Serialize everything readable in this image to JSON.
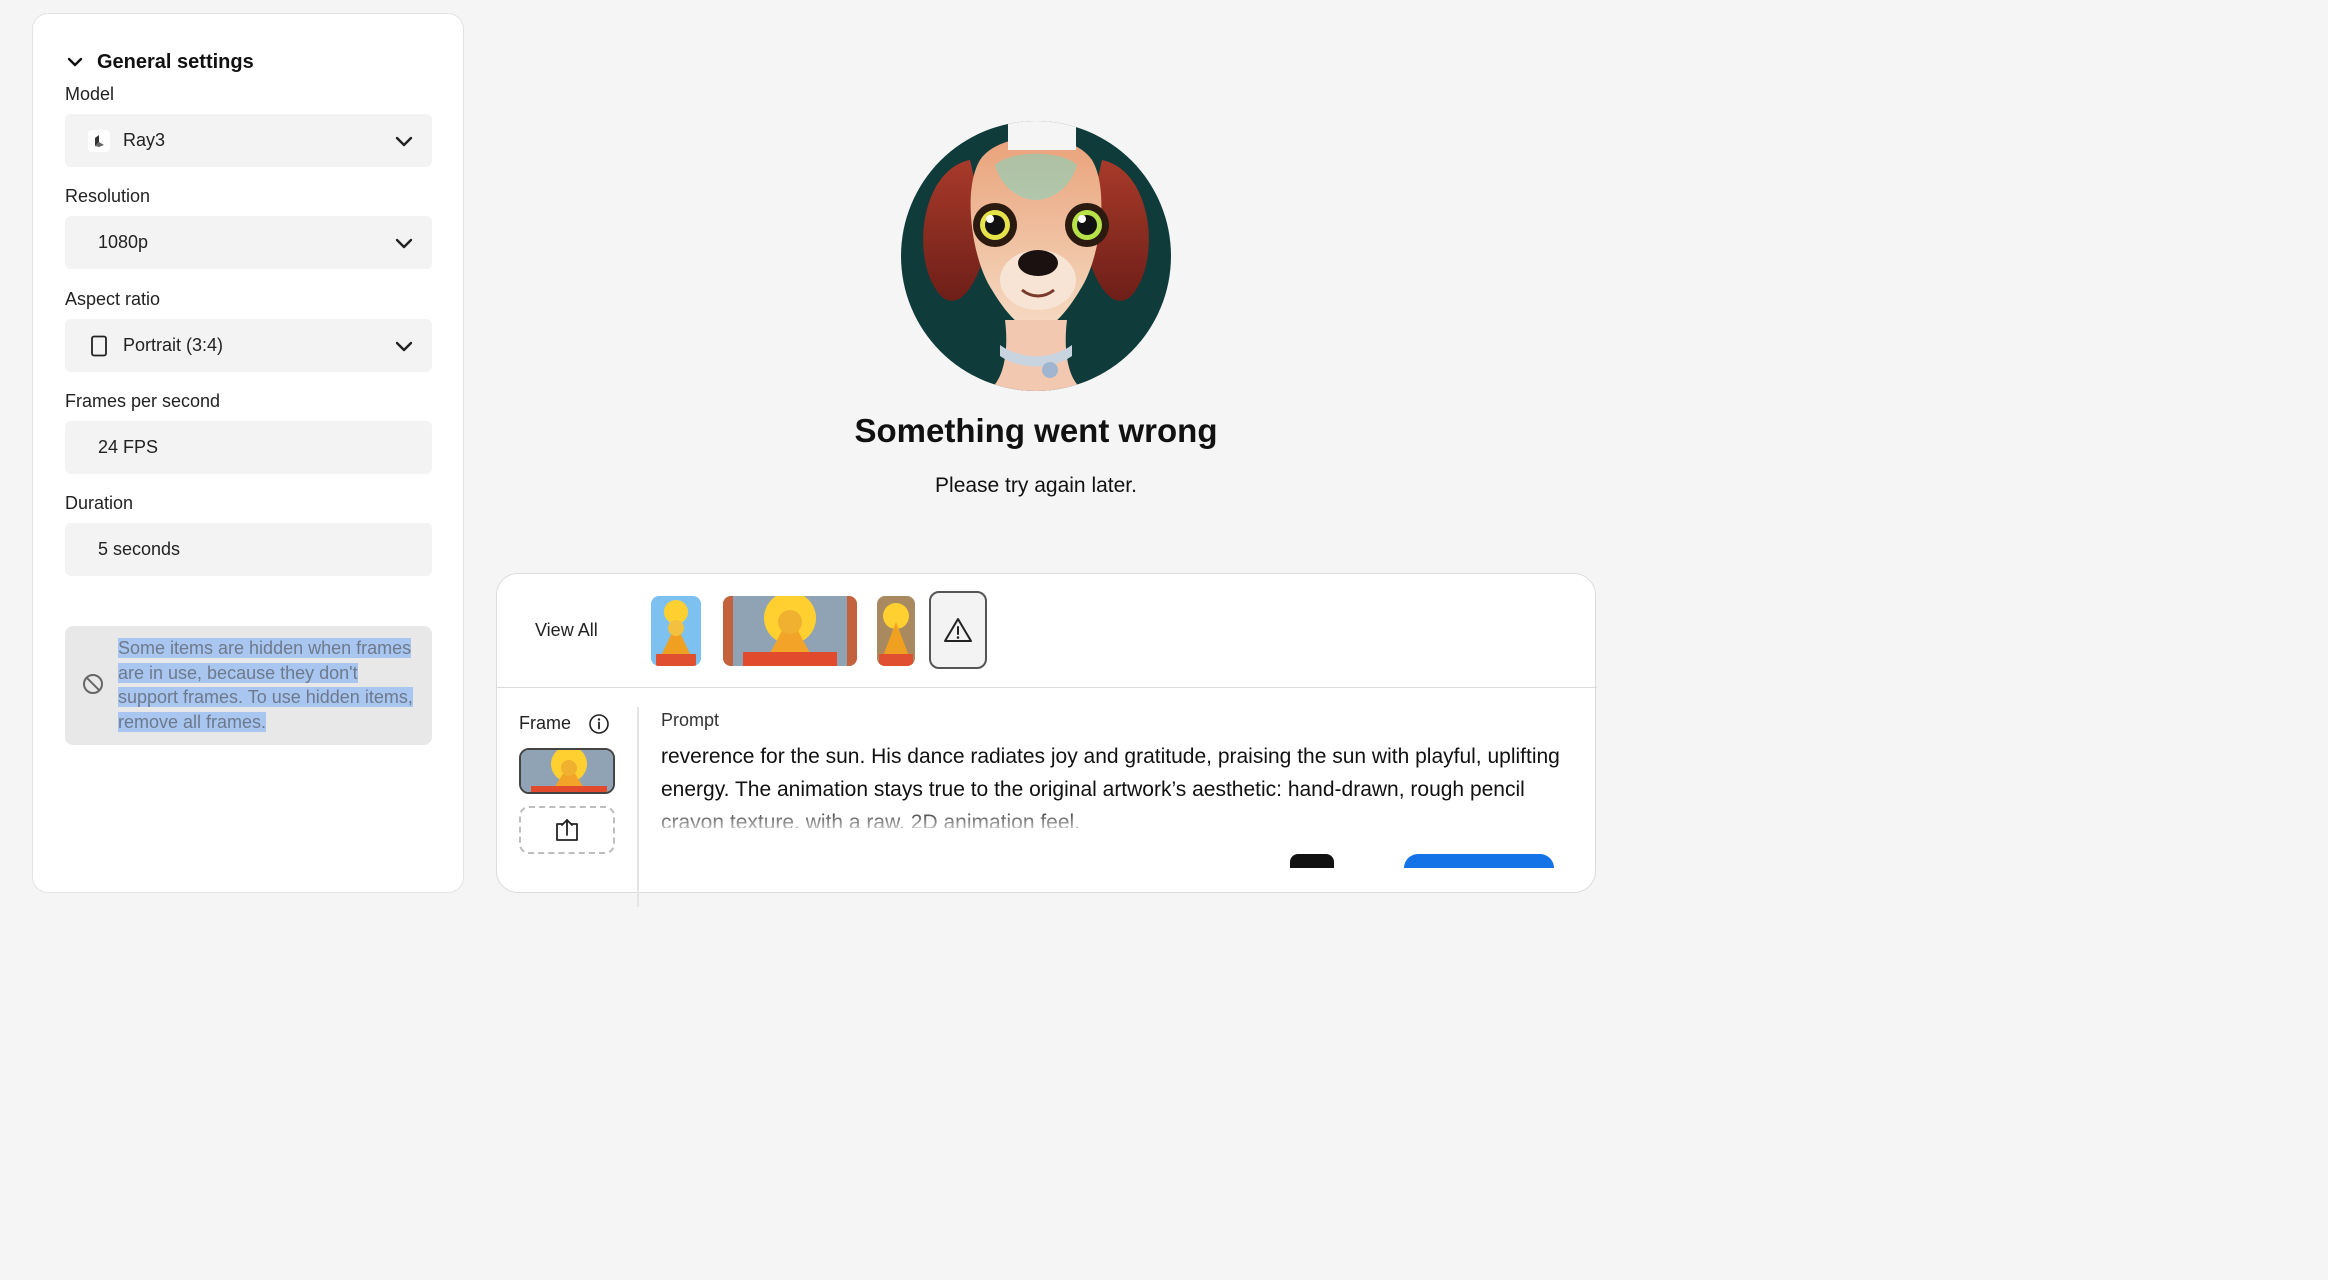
{
  "settings": {
    "section_title": "General settings",
    "model": {
      "label": "Model",
      "value": "Ray3"
    },
    "resolution": {
      "label": "Resolution",
      "value": "1080p"
    },
    "aspect_ratio": {
      "label": "Aspect ratio",
      "value": "Portrait (3:4)"
    },
    "fps": {
      "label": "Frames per second",
      "value": "24 FPS"
    },
    "duration": {
      "label": "Duration",
      "value": "5 seconds"
    },
    "notice": "Some items are hidden when frames are in use, because they don't support frames. To use hidden items, remove all frames."
  },
  "error": {
    "title": "Something went wrong",
    "subtitle": "Please try again later."
  },
  "history": {
    "view_all": "View All"
  },
  "composer": {
    "frame_label": "Frame",
    "prompt_label": "Prompt",
    "prompt_text": "reverence for the sun. His dance radiates joy and gratitude, praising the sun with playful, uplifting energy. The animation stays true to the original artwork’s aesthetic: hand-drawn, rough pencil crayon texture, with a raw, 2D animation feel."
  },
  "icons": {
    "collapse": "chevron-down-icon",
    "model_logo": "luma-logo-icon",
    "portrait": "portrait-icon",
    "hidden": "ban-icon",
    "warning": "warning-icon",
    "info": "info-icon",
    "upload": "upload-icon"
  },
  "colors": {
    "accent": "#1473e6",
    "highlight": "#a8c6f0"
  }
}
